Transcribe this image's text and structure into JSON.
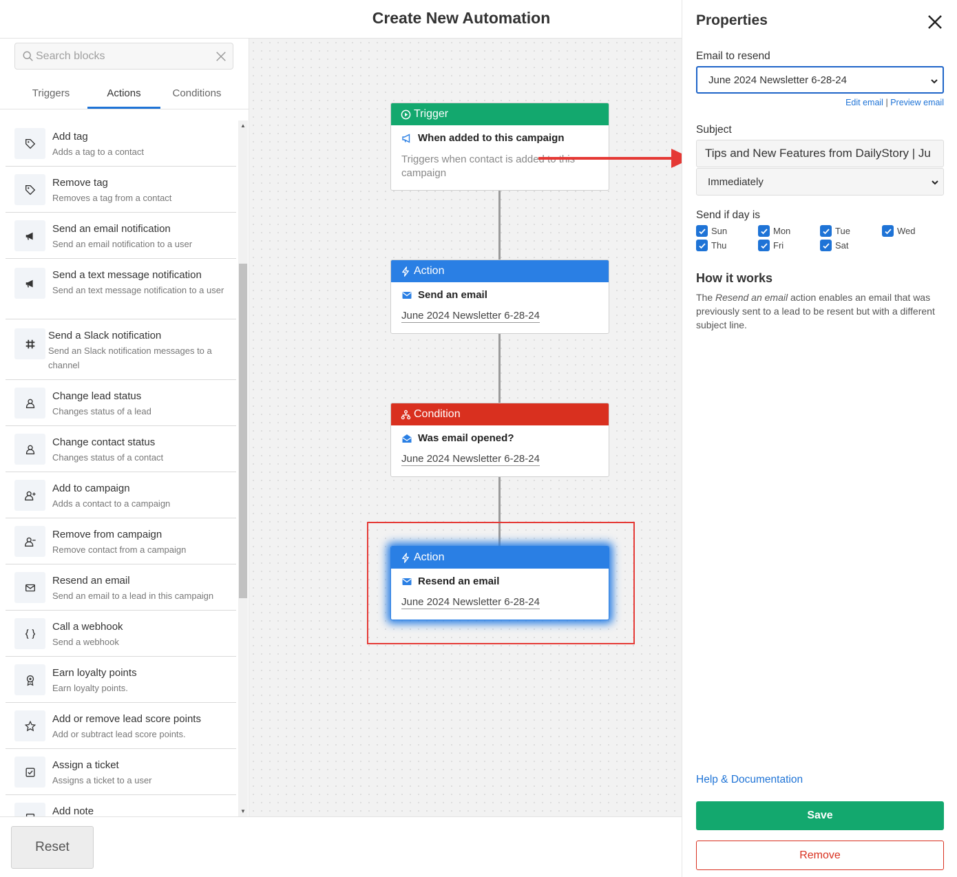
{
  "header": {
    "title": "Create New Automation"
  },
  "search": {
    "placeholder": "Search blocks"
  },
  "tabs": [
    {
      "label": "Triggers"
    },
    {
      "label": "Actions"
    },
    {
      "label": "Conditions"
    }
  ],
  "blocks": [
    {
      "title": "Add tag",
      "desc": "Adds a tag to a contact",
      "icon": "tag-icon"
    },
    {
      "title": "Remove tag",
      "desc": "Removes a tag from a contact",
      "icon": "tag-icon"
    },
    {
      "title": "Send an email notification",
      "desc": "Send an email notification to a user",
      "icon": "bullhorn-icon"
    },
    {
      "title": "Send a text message notification",
      "desc": "Send an text message notification to a user",
      "icon": "bullhorn-icon"
    },
    {
      "title": "Send a Slack notification",
      "desc": "Send an Slack notification messages to a channel",
      "icon": "slack-icon"
    },
    {
      "title": "Change lead status",
      "desc": "Changes status of a lead",
      "icon": "user-icon"
    },
    {
      "title": "Change contact status",
      "desc": "Changes status of a contact",
      "icon": "user-icon"
    },
    {
      "title": "Add to campaign",
      "desc": "Adds a contact to a campaign",
      "icon": "user-plus-icon"
    },
    {
      "title": "Remove from campaign",
      "desc": "Remove contact from a campaign",
      "icon": "user-minus-icon"
    },
    {
      "title": "Resend an email",
      "desc": "Send an email to a lead in this campaign",
      "icon": "envelope-icon"
    },
    {
      "title": "Call a webhook",
      "desc": "Send a webhook",
      "icon": "braces-icon"
    },
    {
      "title": "Earn loyalty points",
      "desc": "Earn loyalty points.",
      "icon": "award-icon"
    },
    {
      "title": "Add or remove lead score points",
      "desc": "Add or subtract lead score points.",
      "icon": "star-icon"
    },
    {
      "title": "Assign a ticket",
      "desc": "Assigns a ticket to a user",
      "icon": "check-square-icon"
    },
    {
      "title": "Add note",
      "desc": "",
      "icon": "note-icon"
    }
  ],
  "footer": {
    "reset_label": "Reset"
  },
  "flow": {
    "trigger": {
      "header": "Trigger",
      "title": "When added to this campaign",
      "desc": "Triggers when contact is added to this campaign"
    },
    "action1": {
      "header": "Action",
      "title": "Send an email",
      "desc": "June 2024 Newsletter 6-28-24"
    },
    "condition": {
      "header": "Condition",
      "title": "Was email opened?",
      "desc": "June 2024 Newsletter 6-28-24"
    },
    "action2": {
      "header": "Action",
      "title": "Resend an email",
      "desc": "June 2024 Newsletter 6-28-24"
    }
  },
  "properties": {
    "title": "Properties",
    "email_label": "Email to resend",
    "email_value": "June 2024 Newsletter 6-28-24",
    "edit_email": "Edit email",
    "link_separator": "|",
    "preview_email": "Preview email",
    "subject_label": "Subject",
    "subject_value": "Tips and New Features from DailyStory | Ju",
    "timing_value": "Immediately",
    "days_label": "Send if day is",
    "days": [
      {
        "label": "Sun",
        "checked": true
      },
      {
        "label": "Mon",
        "checked": true
      },
      {
        "label": "Tue",
        "checked": true
      },
      {
        "label": "Wed",
        "checked": true
      },
      {
        "label": "Thu",
        "checked": true
      },
      {
        "label": "Fri",
        "checked": true
      },
      {
        "label": "Sat",
        "checked": true
      }
    ],
    "how_title": "How it works",
    "how_text_pre": "The ",
    "how_text_em": "Resend an email",
    "how_text_post": " action enables an email that was previously sent to a lead to be resent but with a different subject line.",
    "help_link": "Help & Documentation",
    "save_label": "Save",
    "remove_label": "Remove"
  },
  "colors": {
    "trigger": "#13a86e",
    "action": "#2a7fe4",
    "condition": "#d9301f",
    "highlight": "#e53935",
    "save": "#13a86e",
    "link": "#1e73d6"
  }
}
